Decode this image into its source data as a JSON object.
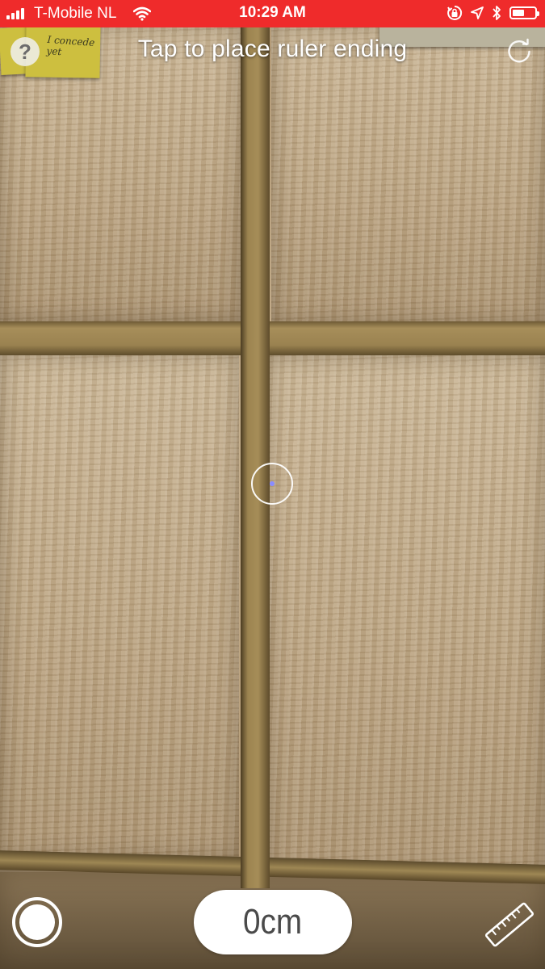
{
  "status_bar": {
    "carrier": "T-Mobile NL",
    "time": "10:29 AM",
    "battery_level": 0.55,
    "icons": [
      "signal-icon",
      "wifi-icon",
      "screen-lock-icon",
      "location-icon",
      "bluetooth-icon",
      "battery-icon"
    ],
    "background_color": "#ef2b2b"
  },
  "header": {
    "help_label": "?",
    "instruction": "Tap to place ruler ending",
    "reset_icon": "reset-icon"
  },
  "background": {
    "sticky_note_text": "I concede yet"
  },
  "footer": {
    "measurement": "0cm",
    "record_icon": "record-icon",
    "ruler_icon": "ruler-icon"
  },
  "colors": {
    "overlay_text": "#ffffff",
    "reticle_dot": "#8a8cff",
    "measurement_text": "#4a4a4a"
  }
}
